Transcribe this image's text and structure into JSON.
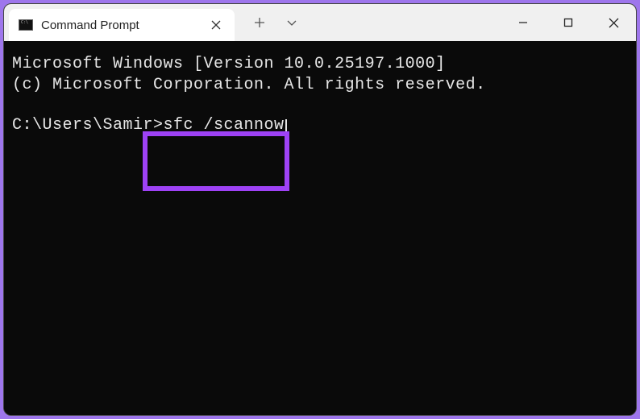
{
  "colors": {
    "accent": "#9e42f5",
    "outer_border": "#9e76ec",
    "terminal_bg": "#0a0a0a",
    "terminal_fg": "#e6e6e6"
  },
  "tab": {
    "title": "Command Prompt",
    "icon_name": "cmd-icon"
  },
  "window_controls": {
    "minimize": "minimize",
    "maximize": "maximize",
    "close": "close"
  },
  "terminal": {
    "line1": "Microsoft Windows [Version 10.0.25197.1000]",
    "line2": "(c) Microsoft Corporation. All rights reserved.",
    "prompt_prefix": "C:\\Users\\Samir>",
    "command": "sfc /scannow"
  },
  "annotation": {
    "highlighted_command": "sfc /scannow"
  }
}
